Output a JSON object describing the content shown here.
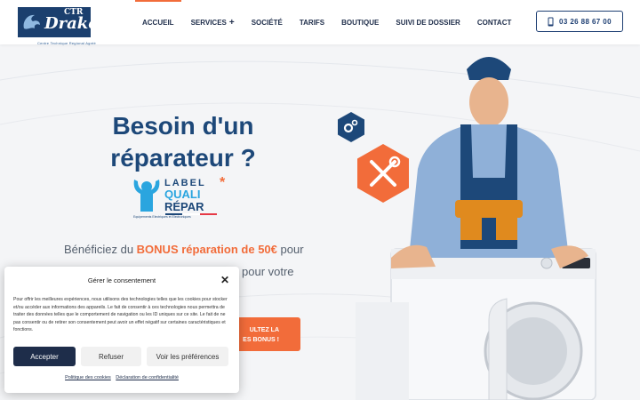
{
  "header": {
    "logo": {
      "prefix": "CTR",
      "name": "Drako",
      "tagline": "Centre Technique Regional Agréé"
    },
    "nav": [
      {
        "label": "ACCUEIL",
        "active": true
      },
      {
        "label": "SERVICES"
      },
      {
        "label": "SOCIÉTÉ"
      },
      {
        "label": "TARIFS"
      },
      {
        "label": "BOUTIQUE"
      },
      {
        "label": "SUIVI DE DOSSIER"
      },
      {
        "label": "CONTACT"
      }
    ],
    "services_plus": "+",
    "phone": "03 26 88 67 00"
  },
  "hero": {
    "title_line1": "Besoin d'un",
    "title_line2": "réparateur ?",
    "label": {
      "line1": "LABEL",
      "line2": "QUALI",
      "line3": "RÉPAR",
      "star": "*",
      "sub": "Equipements Electriques et Electroniques"
    },
    "text_prefix": "Bénéficiez du ",
    "text_bonus": "BONUS réparation de 50€",
    "text_suffix": " pour",
    "text_line2": "pour votre",
    "cta_line1": "ULTEZ LA",
    "cta_line2": "ES BONUS !"
  },
  "cookie": {
    "title": "Gérer le consentement",
    "close": "✕",
    "body": "Pour offrir les meilleures expériences, nous utilisons des technologies telles que les cookies pour stocker et/ou accéder aux informations des appareils. Le fait de consentir à ces technologies nous permettra de traiter des données telles que le comportement de navigation ou les ID uniques sur ce site. Le fait de ne pas consentir ou de retirer son consentement peut avoir un effet négatif sur certaines caractéristiques et fonctions.",
    "accept": "Accepter",
    "refuse": "Refuser",
    "prefs": "Voir les préférences",
    "link1": "Politique des cookies",
    "link2": "Déclaration de confidentialité"
  },
  "colors": {
    "primary": "#1d4879",
    "accent": "#f26c3a",
    "navy": "#1e2d4a",
    "sky": "#2aa5df"
  },
  "icons": [
    "dragon-logo-icon",
    "phone-icon",
    "gears-icon",
    "tools-icon",
    "close-icon"
  ]
}
